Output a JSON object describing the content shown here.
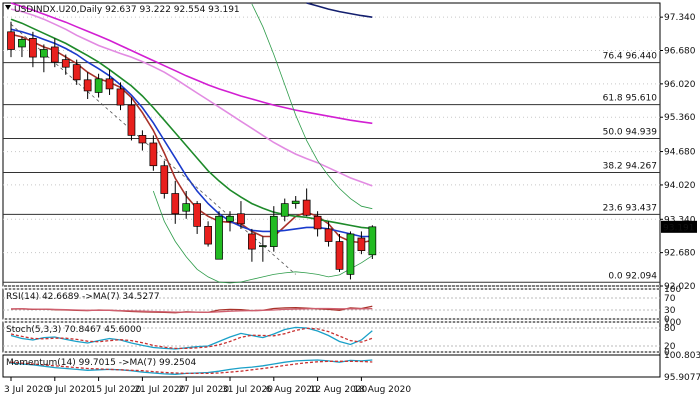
{
  "colors": {
    "bull": "#22bb22",
    "bear": "#e8201d",
    "ma_blue": "#1a3bcc",
    "ma_green": "#1e8a2a",
    "ma_red": "#a8322a",
    "ma_magenta": "#d21fd2",
    "ma_pink": "#e28be2",
    "ma_navy": "#131f6e",
    "bb": "#2e9c4a",
    "fib": "#333333",
    "price_tag_bg": "#000000",
    "stoch_k": "#1aa0c8",
    "stoch_d": "#c83232",
    "rsi_ma": "#d06070"
  },
  "chart_data": [
    {
      "type": "candlestick",
      "title": "USDINDX.U20,Daily",
      "ohlc_header": {
        "open": "92.637",
        "high": "93.222",
        "low": "92.554",
        "close": "93.191"
      },
      "last_price": "93.191",
      "x_labels": [
        "3 Jul 2020",
        "9 Jul 2020",
        "15 Jul 2020",
        "21 Jul 2020",
        "27 Jul 2020",
        "31 Jul 2020",
        "6 Aug 2020",
        "12 Aug 2020",
        "18 Aug 2020"
      ],
      "x_label_index": [
        0,
        4,
        8,
        12,
        16,
        20,
        24,
        28,
        32
      ],
      "y_ticks": [
        "97.340",
        "96.680",
        "96.020",
        "95.360",
        "94.680",
        "94.020",
        "93.340",
        "92.680",
        "92.020"
      ],
      "ylim": [
        92.02,
        97.62
      ],
      "candles": [
        {
          "o": 97.05,
          "h": 97.25,
          "l": 96.55,
          "c": 96.7
        },
        {
          "o": 96.75,
          "h": 96.95,
          "l": 96.55,
          "c": 96.9
        },
        {
          "o": 96.92,
          "h": 97.05,
          "l": 96.35,
          "c": 96.55
        },
        {
          "o": 96.55,
          "h": 96.8,
          "l": 96.25,
          "c": 96.7
        },
        {
          "o": 96.75,
          "h": 96.92,
          "l": 96.35,
          "c": 96.45
        },
        {
          "o": 96.5,
          "h": 96.6,
          "l": 96.2,
          "c": 96.35
        },
        {
          "o": 96.4,
          "h": 96.5,
          "l": 96.0,
          "c": 96.1
        },
        {
          "o": 96.1,
          "h": 96.25,
          "l": 95.72,
          "c": 95.88
        },
        {
          "o": 95.85,
          "h": 96.22,
          "l": 95.75,
          "c": 96.12
        },
        {
          "o": 96.12,
          "h": 96.3,
          "l": 95.8,
          "c": 95.92
        },
        {
          "o": 95.92,
          "h": 96.05,
          "l": 95.5,
          "c": 95.6
        },
        {
          "o": 95.6,
          "h": 95.75,
          "l": 94.9,
          "c": 95.0
        },
        {
          "o": 95.0,
          "h": 95.1,
          "l": 94.7,
          "c": 94.85
        },
        {
          "o": 94.85,
          "h": 95.0,
          "l": 94.3,
          "c": 94.4
        },
        {
          "o": 94.4,
          "h": 94.5,
          "l": 93.75,
          "c": 93.85
        },
        {
          "o": 93.85,
          "h": 94.1,
          "l": 93.25,
          "c": 93.45
        },
        {
          "o": 93.5,
          "h": 93.9,
          "l": 93.35,
          "c": 93.65
        },
        {
          "o": 93.65,
          "h": 93.7,
          "l": 93.05,
          "c": 93.2
        },
        {
          "o": 93.2,
          "h": 93.3,
          "l": 92.8,
          "c": 92.85
        },
        {
          "o": 92.55,
          "h": 93.5,
          "l": 92.55,
          "c": 93.4
        },
        {
          "o": 93.3,
          "h": 93.5,
          "l": 93.1,
          "c": 93.4
        },
        {
          "o": 93.45,
          "h": 93.7,
          "l": 93.15,
          "c": 93.25
        },
        {
          "o": 93.05,
          "h": 93.15,
          "l": 92.5,
          "c": 92.75
        },
        {
          "o": 92.8,
          "h": 93.0,
          "l": 92.5,
          "c": 92.82
        },
        {
          "o": 92.8,
          "h": 93.6,
          "l": 92.7,
          "c": 93.4
        },
        {
          "o": 93.4,
          "h": 93.75,
          "l": 93.3,
          "c": 93.65
        },
        {
          "o": 93.65,
          "h": 93.8,
          "l": 93.55,
          "c": 93.7
        },
        {
          "o": 93.72,
          "h": 93.95,
          "l": 93.4,
          "c": 93.42
        },
        {
          "o": 93.4,
          "h": 93.5,
          "l": 93.0,
          "c": 93.15
        },
        {
          "o": 93.15,
          "h": 93.3,
          "l": 92.8,
          "c": 92.9
        },
        {
          "o": 92.9,
          "h": 93.05,
          "l": 92.3,
          "c": 92.35
        },
        {
          "o": 92.25,
          "h": 93.1,
          "l": 92.15,
          "c": 93.05
        },
        {
          "o": 92.97,
          "h": 93.1,
          "l": 92.65,
          "c": 92.72
        },
        {
          "o": 92.637,
          "h": 93.222,
          "l": 92.554,
          "c": 93.191
        }
      ],
      "fib_levels": [
        {
          "label": "76.4 96.440",
          "value": 96.44
        },
        {
          "label": "61.8 95.610",
          "value": 95.61
        },
        {
          "label": "50.0 94.939",
          "value": 94.939
        },
        {
          "label": "38.2 94.267",
          "value": 94.267
        },
        {
          "label": "23.6 93.437",
          "value": 93.437
        },
        {
          "label": "0.0 92.094",
          "value": 92.094
        }
      ],
      "series": [
        {
          "color": "ma_red",
          "values": [
            97.0,
            96.95,
            96.85,
            96.75,
            96.68,
            96.55,
            96.42,
            96.25,
            96.12,
            96.05,
            95.95,
            95.75,
            95.45,
            95.1,
            94.65,
            94.15,
            93.8,
            93.55,
            93.4,
            93.3,
            93.28,
            93.25,
            93.1,
            93.0,
            93.0,
            93.2,
            93.4,
            93.48,
            93.4,
            93.25,
            93.0,
            92.9,
            92.88,
            92.92
          ]
        },
        {
          "color": "ma_blue",
          "values": [
            97.1,
            97.05,
            96.98,
            96.9,
            96.82,
            96.72,
            96.6,
            96.45,
            96.32,
            96.18,
            96.0,
            95.8,
            95.55,
            95.25,
            94.9,
            94.55,
            94.2,
            93.9,
            93.65,
            93.45,
            93.3,
            93.2,
            93.12,
            93.1,
            93.1,
            93.12,
            93.15,
            93.18,
            93.18,
            93.15,
            93.1,
            93.05,
            93.0,
            93.0
          ]
        },
        {
          "color": "ma_green",
          "values": [
            97.3,
            97.22,
            97.12,
            97.02,
            96.92,
            96.82,
            96.7,
            96.58,
            96.45,
            96.3,
            96.14,
            95.98,
            95.78,
            95.55,
            95.3,
            95.05,
            94.8,
            94.55,
            94.3,
            94.1,
            93.92,
            93.78,
            93.65,
            93.56,
            93.48,
            93.43,
            93.4,
            93.38,
            93.34,
            93.3,
            93.26,
            93.22,
            93.18,
            93.16
          ]
        },
        {
          "color": "ma_magenta",
          "values": [
            97.62,
            97.55,
            97.48,
            97.4,
            97.32,
            97.24,
            97.15,
            97.06,
            96.97,
            96.88,
            96.78,
            96.68,
            96.58,
            96.48,
            96.38,
            96.28,
            96.18,
            96.09,
            96.0,
            95.92,
            95.85,
            95.78,
            95.72,
            95.66,
            95.6,
            95.55,
            95.5,
            95.46,
            95.42,
            95.38,
            95.34,
            95.3,
            95.27,
            95.24
          ]
        },
        {
          "color": "ma_pink",
          "values": [
            97.5,
            97.45,
            97.38,
            97.3,
            97.2,
            97.1,
            96.98,
            96.88,
            96.78,
            96.7,
            96.62,
            96.55,
            96.46,
            96.36,
            96.25,
            96.12,
            95.98,
            95.84,
            95.7,
            95.56,
            95.42,
            95.28,
            95.14,
            95.0,
            94.86,
            94.74,
            94.63,
            94.54,
            94.46,
            94.36,
            94.26,
            94.16,
            94.08,
            94.0
          ]
        },
        {
          "color": "ma_navy",
          "values": [
            null,
            null,
            null,
            null,
            null,
            null,
            null,
            null,
            null,
            null,
            null,
            null,
            null,
            null,
            null,
            null,
            null,
            null,
            null,
            null,
            null,
            null,
            null,
            null,
            null,
            null,
            null,
            97.62,
            97.56,
            97.5,
            97.45,
            97.41,
            97.37,
            97.34
          ]
        },
        {
          "color": "bb",
          "values": [
            null,
            null,
            null,
            null,
            null,
            null,
            null,
            null,
            null,
            null,
            null,
            null,
            null,
            null,
            null,
            null,
            null,
            null,
            null,
            null,
            null,
            null,
            97.6,
            97.15,
            96.6,
            96.0,
            95.4,
            94.9,
            94.5,
            94.2,
            93.95,
            93.75,
            93.6,
            93.55
          ]
        },
        {
          "color": "bb",
          "values": [
            null,
            null,
            null,
            null,
            null,
            null,
            null,
            null,
            null,
            null,
            null,
            null,
            null,
            93.9,
            93.3,
            92.9,
            92.6,
            92.35,
            92.2,
            92.1,
            92.08,
            92.1,
            92.15,
            92.2,
            92.25,
            92.28,
            92.3,
            92.28,
            92.25,
            92.2,
            92.24,
            92.36,
            92.48,
            92.62
          ]
        }
      ]
    },
    {
      "type": "line",
      "title": "RSI(14) 42.6689 ->MA(7) 34.5277",
      "y_ticks": [
        "100",
        "70",
        "30",
        "0"
      ],
      "ylim": [
        0,
        100
      ],
      "series": [
        {
          "color": "ma_red",
          "values": [
            33,
            34,
            32,
            33,
            31,
            30,
            29,
            28,
            30,
            29,
            27,
            25,
            24,
            23,
            22,
            21,
            24,
            23,
            22,
            30,
            32,
            31,
            28,
            29,
            35,
            37,
            38,
            36,
            34,
            32,
            29,
            37,
            35,
            42.67
          ]
        },
        {
          "color": "rsi_ma",
          "values": [
            34,
            34,
            33,
            33,
            32,
            31,
            30,
            29,
            29,
            29,
            28,
            27,
            26,
            25,
            24,
            23,
            23,
            23,
            22,
            24,
            26,
            27,
            28,
            29,
            30,
            32,
            33,
            34,
            35,
            35,
            34,
            34,
            34,
            34.53
          ]
        }
      ]
    },
    {
      "type": "line",
      "title": "Stoch(5,3,3) 70.8467 45.6000",
      "y_ticks": [
        "100",
        "80",
        "20",
        "0"
      ],
      "ylim": [
        0,
        100
      ],
      "series": [
        {
          "color": "stoch_k",
          "values": [
            55,
            45,
            40,
            48,
            50,
            42,
            35,
            30,
            38,
            45,
            40,
            30,
            22,
            15,
            12,
            10,
            14,
            18,
            20,
            35,
            50,
            62,
            55,
            48,
            60,
            75,
            82,
            80,
            70,
            55,
            35,
            25,
            40,
            70.85
          ]
        },
        {
          "color": "stoch_d",
          "values": [
            60,
            52,
            45,
            44,
            46,
            46,
            42,
            36,
            34,
            38,
            41,
            38,
            31,
            22,
            16,
            12,
            12,
            14,
            17,
            24,
            35,
            49,
            56,
            55,
            54,
            61,
            72,
            79,
            77,
            68,
            53,
            38,
            33,
            45.6
          ]
        }
      ]
    },
    {
      "type": "line",
      "title": "Momentum(14) 99.7015 ->MA(7) 99.2504",
      "y_ticks": [
        "100.8032",
        "95.9077"
      ],
      "ylim": [
        95.9077,
        100.8032
      ],
      "series": [
        {
          "color": "stoch_k",
          "values": [
            99.0,
            98.8,
            98.6,
            98.3,
            98.0,
            97.8,
            97.6,
            97.4,
            97.5,
            97.6,
            97.5,
            97.3,
            97.0,
            96.8,
            96.6,
            96.5,
            96.7,
            96.8,
            96.9,
            97.2,
            97.6,
            97.9,
            98.1,
            98.4,
            98.8,
            99.2,
            99.5,
            99.6,
            99.7,
            99.5,
            99.2,
            99.6,
            99.5,
            99.7015
          ]
        },
        {
          "color": "stoch_d",
          "values": [
            99.2,
            99.0,
            98.8,
            98.6,
            98.4,
            98.2,
            98.0,
            97.8,
            97.7,
            97.6,
            97.5,
            97.4,
            97.3,
            97.1,
            96.9,
            96.8,
            96.7,
            96.7,
            96.7,
            96.8,
            97.0,
            97.2,
            97.5,
            97.8,
            98.1,
            98.5,
            98.8,
            99.1,
            99.3,
            99.4,
            99.4,
            99.4,
            99.35,
            99.2504
          ]
        }
      ]
    }
  ]
}
